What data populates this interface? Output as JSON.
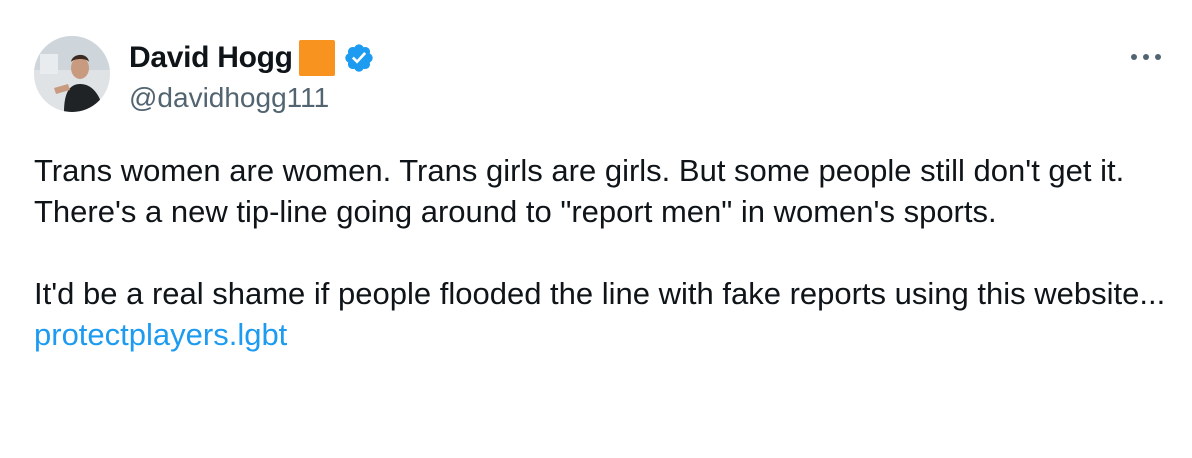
{
  "author": {
    "display_name": "David Hogg",
    "handle": "@davidhogg111",
    "avatar_icon": "profile-photo",
    "affiliate_badge_color": "#f7931e",
    "verified_color": "#1d9bf0"
  },
  "tweet": {
    "paragraph_1": "Trans women are women. Trans girls are girls. But some people still don't get it. There's a new tip-line going around to \"report men\" in women's sports.",
    "paragraph_2_text": "It'd be a real shame if people flooded the line with fake reports using this website... ",
    "link_text": "protectplayers.lgbt"
  },
  "menu": {
    "more_icon": "more-horizontal-icon"
  },
  "colors": {
    "text": "#0f1419",
    "secondary_text": "#536471",
    "link": "#1d9bf0"
  }
}
